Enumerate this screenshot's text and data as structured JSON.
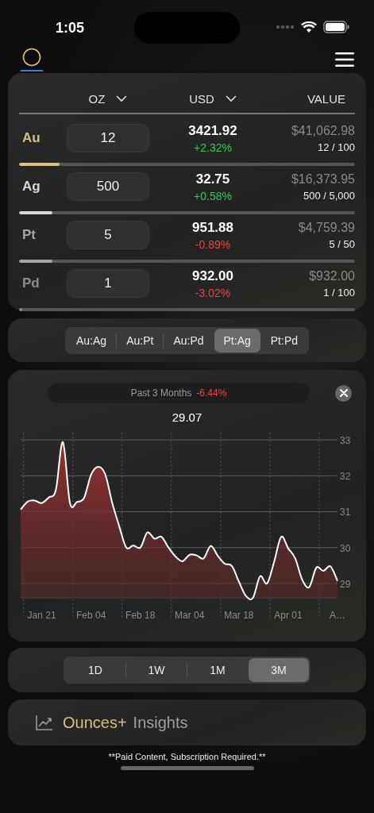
{
  "status_bar": {
    "time": "1:05"
  },
  "holdings": {
    "columns": [
      {
        "label": "OZ",
        "sortable": true
      },
      {
        "label": "USD",
        "sortable": true
      },
      {
        "label": "VALUE",
        "sortable": false
      }
    ],
    "rows": [
      {
        "symbol": "Au",
        "color": "#d8bf80",
        "quantity": "12",
        "price": "3421.92",
        "change": "+2.32%",
        "value": "$41,062.98",
        "ratio": "12 / 100",
        "level": 0.12
      },
      {
        "symbol": "Ag",
        "color": "#d6d6d6",
        "quantity": "500",
        "price": "32.75",
        "change": "+0.58%",
        "value": "$16,373.95",
        "ratio": "500 / 5,000",
        "level": 0.1
      },
      {
        "symbol": "Pt",
        "color": "#a6a6a6",
        "quantity": "5",
        "price": "951.88",
        "change": "-0.89%",
        "value": "$4,759.39",
        "ratio": "5 / 50",
        "level": 0.1
      },
      {
        "symbol": "Pd",
        "color": "#8c8c8c",
        "quantity": "1",
        "price": "932.00",
        "change": "-3.02%",
        "value": "$932.00",
        "ratio": "1 / 100",
        "level": 0.01
      }
    ]
  },
  "ratio_tabs": [
    {
      "label": "Au:Ag",
      "selected": false
    },
    {
      "label": "Au:Pt",
      "selected": false
    },
    {
      "label": "Au:Pd",
      "selected": false
    },
    {
      "label": "Pt:Ag",
      "selected": true
    },
    {
      "label": "Pt:Pd",
      "selected": false
    }
  ],
  "chart": {
    "period": "Past 3 Months",
    "change": "-6.44%",
    "current": "29.07",
    "chart_data": {
      "type": "area",
      "grid": true,
      "ylim": [
        28.6,
        33.2
      ],
      "categories": [
        null,
        null,
        null,
        "Jan 21",
        null,
        null,
        null,
        null,
        null,
        null,
        "Feb 04",
        null,
        null,
        null,
        null,
        null,
        null,
        "Feb 18",
        null,
        null,
        null,
        null,
        null,
        null,
        "Mar 04",
        null,
        null,
        null,
        null,
        null,
        null,
        "Mar 18",
        null,
        null,
        null,
        null,
        null,
        null,
        "Apr 01",
        null,
        null,
        null,
        null,
        null,
        null,
        "A…"
      ],
      "series": [
        {
          "color": "#ffffff",
          "values": [
            31.06,
            31.28,
            31.31,
            31.24,
            31.4,
            31.6,
            32.94,
            31.24,
            31.27,
            31.38,
            32.03,
            32.25,
            32.05,
            31.25,
            30.6,
            30.0,
            30.06,
            30.0,
            30.42,
            30.25,
            30.3,
            30.0,
            29.75,
            29.62,
            29.8,
            29.78,
            29.7,
            30.05,
            29.77,
            29.55,
            29.49,
            29.05,
            28.65,
            28.6,
            29.2,
            29.0,
            29.6,
            30.3,
            29.98,
            29.7,
            29.1,
            28.9,
            29.44,
            29.35,
            29.48,
            29.07
          ]
        }
      ],
      "yticks": [
        29,
        30,
        31,
        32,
        33
      ]
    }
  },
  "ranges": [
    {
      "label": "1D",
      "selected": false
    },
    {
      "label": "1W",
      "selected": false
    },
    {
      "label": "1M",
      "selected": false
    },
    {
      "label": "3M",
      "selected": true
    }
  ],
  "insights": {
    "brand": "Ounces+",
    "label": "Insights"
  },
  "footer": "**Paid Content, Subscription Required.**"
}
